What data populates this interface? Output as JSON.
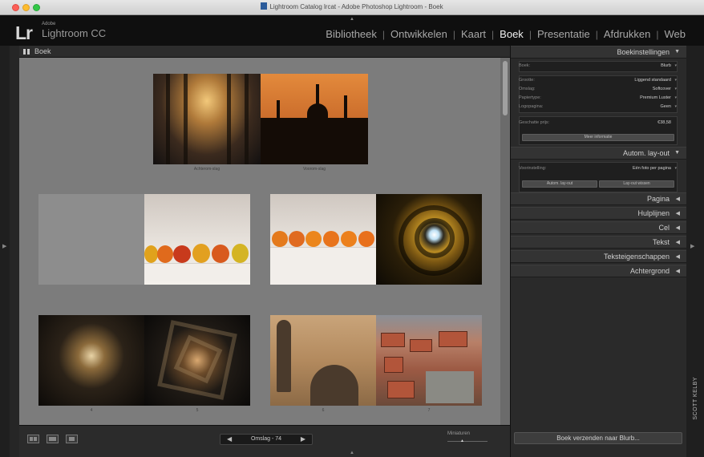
{
  "window": {
    "title": "Lightroom Catalog lrcat - Adobe Photoshop Lightroom - Boek"
  },
  "identity": {
    "mark": "Lr",
    "adobe": "Adobe",
    "product": "Lightroom CC"
  },
  "modules": [
    {
      "label": "Bibliotheek",
      "active": false
    },
    {
      "label": "Ontwikkelen",
      "active": false
    },
    {
      "label": "Kaart",
      "active": false
    },
    {
      "label": "Boek",
      "active": true
    },
    {
      "label": "Presentatie",
      "active": false
    },
    {
      "label": "Afdrukken",
      "active": false
    },
    {
      "label": "Web",
      "active": false
    }
  ],
  "view": {
    "header_label": "Boek"
  },
  "spreads": [
    {
      "left_caption": "Achterom-slag",
      "right_caption": "Voorom-slag"
    },
    {
      "left_caption": "",
      "right_caption": ""
    },
    {
      "left_caption": "",
      "right_caption": ""
    },
    {
      "left_caption": "4",
      "right_caption": "5"
    },
    {
      "left_caption": "6",
      "right_caption": "7"
    }
  ],
  "toolbar": {
    "pager_text": "Omslag - 74",
    "thumbnails_label": "Miniaturen"
  },
  "book_settings": {
    "header": "Boekinstellingen",
    "rows": [
      {
        "key": "Boek:",
        "value": "Blurb"
      },
      {
        "key": "Grootte:",
        "value": "Liggend standaard"
      },
      {
        "key": "Omslag:",
        "value": "Softcover"
      },
      {
        "key": "Papiertype:",
        "value": "Premium Luster"
      },
      {
        "key": "Logopagina:",
        "value": "Geen"
      },
      {
        "key": "Geschatte prijs:",
        "value": "€38,58"
      }
    ],
    "learn_more": "Meer informatie"
  },
  "auto_layout": {
    "header": "Autom. lay-out",
    "preset_key": "Voorinstelling:",
    "preset_value": "Eén foto per pagina",
    "auto_layout_button": "Autom. lay-out",
    "clear_layout_button": "Lay-out wissen"
  },
  "panels": [
    "Pagina",
    "Hulplijnen",
    "Cel",
    "Tekst",
    "Teksteigenschappen",
    "Achtergrond"
  ],
  "send_button": "Boek verzenden naar Blurb...",
  "credit": "SCOTT KELBY"
}
